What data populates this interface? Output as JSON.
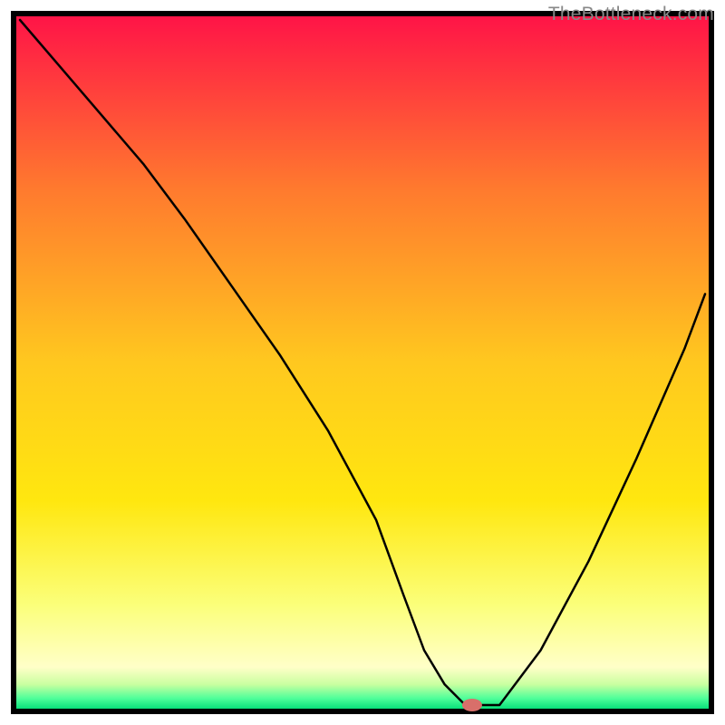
{
  "attribution": "TheBottleneck.com",
  "chart_data": {
    "type": "line",
    "title": "",
    "xlabel": "",
    "ylabel": "",
    "xlim": [
      0,
      100
    ],
    "ylim": [
      0,
      100
    ],
    "grid": false,
    "legend": false,
    "background_gradient": {
      "stops": [
        {
          "pos": 0.0,
          "color": "#ff1447"
        },
        {
          "pos": 0.25,
          "color": "#ff7a2e"
        },
        {
          "pos": 0.5,
          "color": "#ffc81f"
        },
        {
          "pos": 0.7,
          "color": "#ffe70f"
        },
        {
          "pos": 0.85,
          "color": "#fbff7a"
        },
        {
          "pos": 0.94,
          "color": "#ffffc8"
        },
        {
          "pos": 0.965,
          "color": "#c9ffa0"
        },
        {
          "pos": 0.985,
          "color": "#4fff9a"
        },
        {
          "pos": 1.0,
          "color": "#08e07a"
        }
      ]
    },
    "series": [
      {
        "name": "bottleneck-curve",
        "x": [
          0,
          6,
          12,
          18,
          24,
          31,
          38,
          45,
          52,
          56,
          59,
          62,
          65,
          70,
          76,
          83,
          90,
          97,
          100
        ],
        "y": [
          100,
          93,
          86,
          79,
          71,
          61,
          51,
          40,
          27,
          16,
          8,
          3,
          0,
          0,
          8,
          21,
          36,
          52,
          60
        ]
      }
    ],
    "marker": {
      "name": "optimal-marker",
      "x": 66,
      "y": 0,
      "color": "#d86f6a",
      "rx": 11,
      "ry": 7
    }
  }
}
